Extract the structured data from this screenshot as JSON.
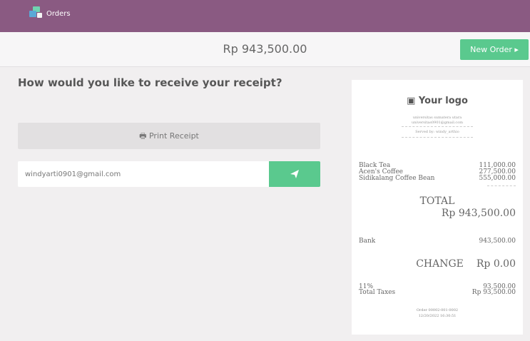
{
  "topbar": {
    "app_name": "Orders",
    "logo_icon": "odoo-logo-icon"
  },
  "header": {
    "amount": "Rp 943,500.00",
    "new_order_label": "New Order ▸"
  },
  "receipt_options": {
    "question": "How would you like to receive your receipt?",
    "print_label": "🖶 Print Receipt",
    "email_value": "windyarti0901@gmail.com",
    "send_icon": "paper-plane-icon"
  },
  "receipt": {
    "logo_label": "▣ Your logo",
    "company_lines": [
      "universitas sumatera utara",
      "universitas0901@gmail.com",
      "Served by: windy_arthio"
    ],
    "items": [
      {
        "name": "Black Tea",
        "price": "111,000.00"
      },
      {
        "name": "Acen's Coffee",
        "price": "277,500.00"
      },
      {
        "name": "Sidikalang Coffee Bean",
        "price": "555,000.00"
      }
    ],
    "total_label": "TOTAL",
    "total_value": "Rp 943,500.00",
    "payment_method": "Bank",
    "payment_amount": "943,500.00",
    "change_label": "CHANGE",
    "change_value": "Rp 0.00",
    "tax_name": "11%",
    "tax_value": "93,500.00",
    "total_taxes_label": "Total Taxes",
    "total_taxes_value": "Rp 93,500.00",
    "order_ref": "Order 00002-001-0002",
    "order_date": "12/20/2022 16:30:51"
  },
  "colors": {
    "topbar": "#8a5a82",
    "accent": "#5ac98e",
    "background": "#f1eff0"
  }
}
